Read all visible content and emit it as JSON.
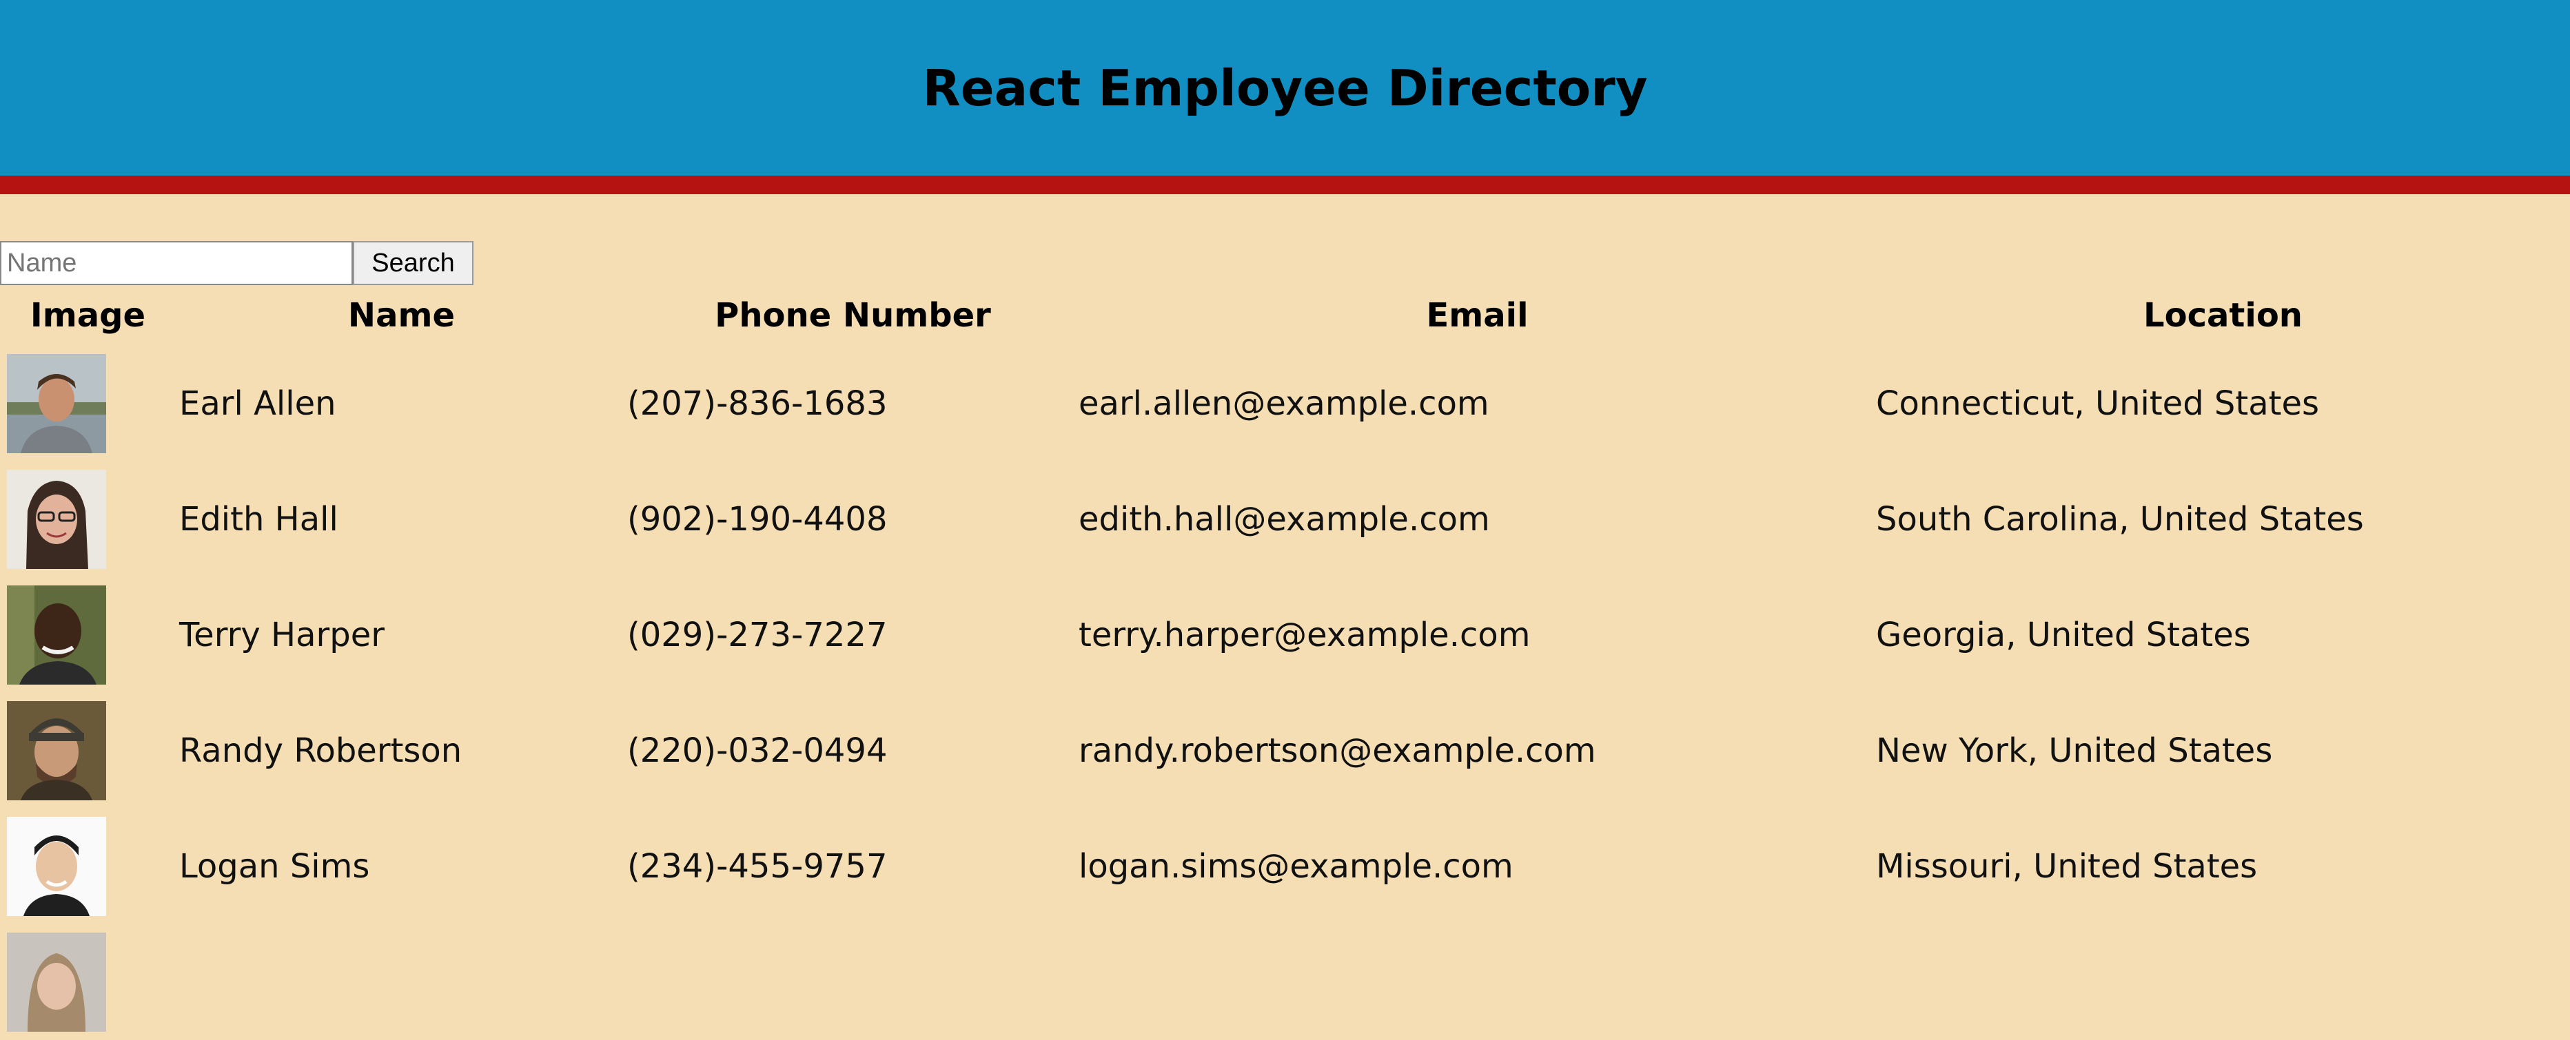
{
  "header": {
    "title": "React Employee Directory"
  },
  "search": {
    "placeholder": "Name",
    "value": "",
    "button_label": "Search"
  },
  "table": {
    "columns": [
      "Image",
      "Name",
      "Phone Number",
      "Email",
      "Location"
    ],
    "rows": [
      {
        "name": "Earl Allen",
        "phone": "(207)-836-1683",
        "email": "earl.allen@example.com",
        "location": "Connecticut, United States"
      },
      {
        "name": "Edith Hall",
        "phone": "(902)-190-4408",
        "email": "edith.hall@example.com",
        "location": "South Carolina, United States"
      },
      {
        "name": "Terry Harper",
        "phone": "(029)-273-7227",
        "email": "terry.harper@example.com",
        "location": "Georgia, United States"
      },
      {
        "name": "Randy Robertson",
        "phone": "(220)-032-0494",
        "email": "randy.robertson@example.com",
        "location": "New York, United States"
      },
      {
        "name": "Logan Sims",
        "phone": "(234)-455-9757",
        "email": "logan.sims@example.com",
        "location": "Missouri, United States"
      }
    ]
  },
  "colors": {
    "header_bg": "#118fc3",
    "accent_bar": "#b51212",
    "page_bg": "#f5deb3"
  }
}
